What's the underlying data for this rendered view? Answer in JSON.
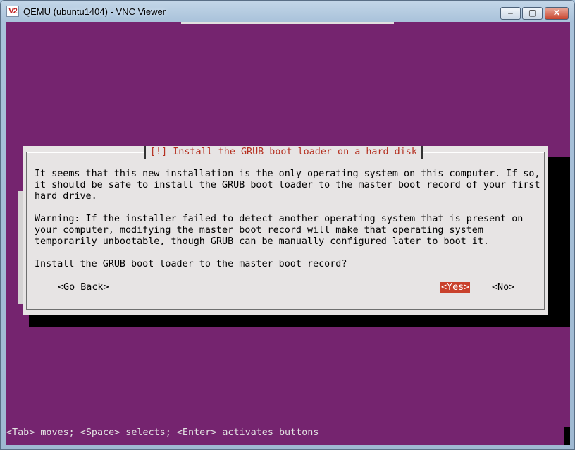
{
  "window": {
    "title": "QEMU (ubuntu1404) - VNC Viewer",
    "icon_label": "V2",
    "controls": {
      "minimize": "–",
      "maximize": "▢",
      "close": "✕"
    }
  },
  "dialog": {
    "title": "[!] Install the GRUB boot loader on a hard disk",
    "paragraphs": [
      "It seems that this new installation is the only operating system on this computer. If so,\nit should be safe to install the GRUB boot loader to the master boot record of your first\nhard drive.",
      "Warning: If the installer failed to detect another operating system that is present on\nyour computer, modifying the master boot record will make that operating system\ntemporarily unbootable, though GRUB can be manually configured later to boot it.",
      "Install the GRUB boot loader to the master boot record?"
    ],
    "buttons": {
      "go_back": "<Go Back>",
      "yes": "<Yes>",
      "no": "<No>"
    }
  },
  "status_bar": "<Tab> moves; <Space> selects; <Enter> activates buttons",
  "colors": {
    "background": "#75246f",
    "dialog_bg": "#e7e4e4",
    "title_text": "#b53020",
    "selected_button": "#c9412c"
  }
}
